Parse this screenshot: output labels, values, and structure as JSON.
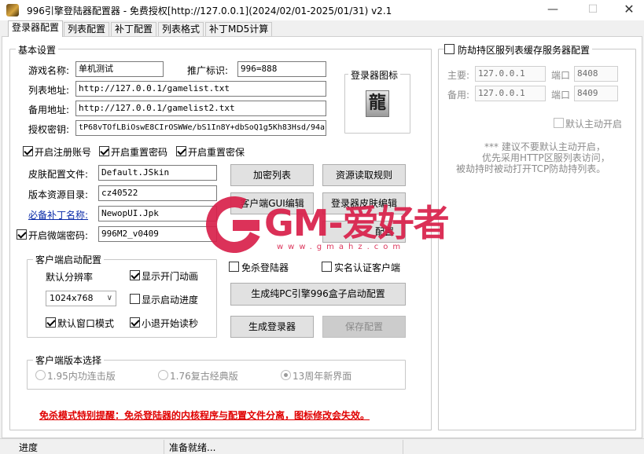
{
  "window": {
    "title": "996引擎登陆器配置器 - 免费授权[http://127.0.0.1](2024/02/01-2025/01/31) v2.1",
    "minimize_icon": "minimize-icon",
    "maximize_icon": "maximize-icon",
    "close_icon": "close-icon"
  },
  "tabs": [
    "登录器配置",
    "列表配置",
    "补丁配置",
    "列表格式",
    "补丁MD5计算"
  ],
  "basic": {
    "group_label": "基本设置",
    "game_name_label": "游戏名称:",
    "game_name_value": "单机测试",
    "promo_label": "推广标识:",
    "promo_value": "996=888",
    "list_url_label": "列表地址:",
    "list_url_value": "http://127.0.0.1/gamelist.txt",
    "backup_url_label": "备用地址:",
    "backup_url_value": "http://127.0.0.1/gamelist2.txt",
    "auth_key_label": "授权密钥:",
    "auth_key_value": "tP68vTOfLBiOswE8CIrOSWWe/bS1In8Y+dbSoQ1g5Kh83Hsd/94a",
    "icon_group_label": "登录器图标",
    "icon_glyph": "龍",
    "enable_register": "开启注册账号",
    "enable_reset_pw": "开启重置密码",
    "enable_reset_protect": "开启重置密保",
    "skin_label": "皮肤配置文件:",
    "skin_value": "Default.JSkin",
    "res_dir_label": "版本资源目录:",
    "res_dir_value": "cz40522",
    "patch_name_label": "必备补丁名称:",
    "patch_name_value": "NewopUI.Jpk",
    "enable_micro_label": "开启微端密码:",
    "micro_value": "996M2_v0409",
    "btn_encrypt_list": "加密列表",
    "btn_res_rule": "资源读取规则",
    "btn_client_gui": "客户端GUI编辑",
    "btn_skin_edit": "登录器皮肤编辑",
    "btn_hidden_partial": "配置"
  },
  "client_start": {
    "group_label": "客户端启动配置",
    "resolution_label": "默认分辨率",
    "resolution_value": "1024x768",
    "show_door_anim": "显示开门动画",
    "show_progress": "显示启动进度",
    "default_window": "默认窗口模式",
    "quit_countdown": "小退开始读秒"
  },
  "options": {
    "no_kill_launcher": "免杀登陆器",
    "realname_client": "实名认证客户端",
    "btn_gen_box": "生成纯PC引擎996盒子启动配置",
    "btn_gen_launcher": "生成登录器",
    "btn_save_config": "保存配置"
  },
  "version_select": {
    "group_label": "客户端版本选择",
    "options": [
      "1.95内功连击版",
      "1.76复古经典版",
      "13周年新界面"
    ],
    "selected_index": 2
  },
  "warning_text": "免杀模式特别提醒：免杀登陆器的内核程序与配置文件分离，图标修改会失效。",
  "anti_hijack": {
    "group_label": "防劫持区服列表缓存服务器配置",
    "primary_label": "主要:",
    "primary_ip": "127.0.0.1",
    "port_label": "端口",
    "primary_port": "8408",
    "backup_label": "备用:",
    "backup_ip": "127.0.0.1",
    "backup_port": "8409",
    "default_on_label": "默认主动开启",
    "note_line1": "*** 建议不要默认主动开启，",
    "note_line2": "优先采用HTTP区服列表访问，",
    "note_line3": "被劫持时被动打开TCP防劫持列表。"
  },
  "watermark": {
    "text": "GM-爱好者",
    "url": "www.gmahz.com"
  },
  "status": {
    "progress_label": "进度",
    "message": "准备就绪..."
  }
}
